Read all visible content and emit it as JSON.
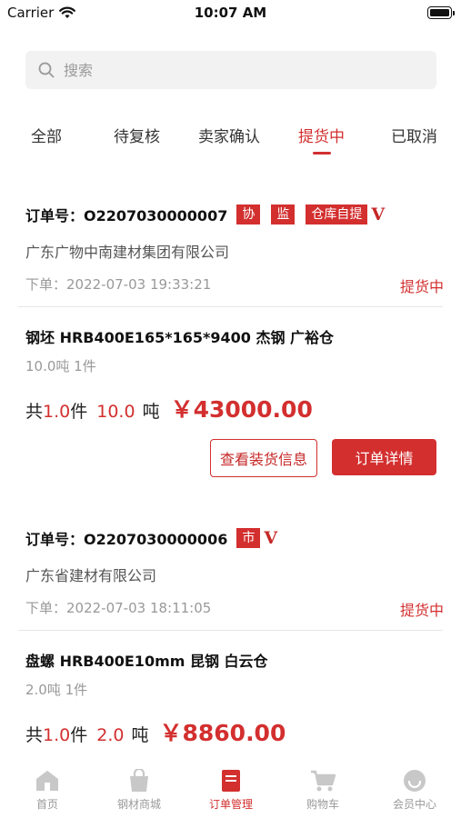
{
  "status_bar": {
    "carrier": "Carrier",
    "time": "10:07 AM"
  },
  "search": {
    "placeholder": "搜索"
  },
  "tabs": [
    {
      "label": "全部",
      "active": false
    },
    {
      "label": "待复核",
      "active": false
    },
    {
      "label": "卖家确认",
      "active": false
    },
    {
      "label": "提货中",
      "active": true
    },
    {
      "label": "已取消",
      "active": false
    }
  ],
  "orders": [
    {
      "order_no": "订单号：O2207030000007",
      "tags": [
        "协",
        "监",
        "仓库自提"
      ],
      "vip_mark": "V",
      "company": "广东广物中南建材集团有限公司",
      "time": "下单：2022-07-03 19:33:21",
      "status": "提货中",
      "product_name": "钢坯 HRB400E165*165*9400 杰钢 广裕仓",
      "product_qty": "10.0吨 1件",
      "summary_prefix": "共",
      "count": "1.0",
      "count_unit": "件",
      "weight": "10.0",
      "weight_unit": "吨",
      "price": "￥43000.00",
      "btn_loading": "查看装货信息",
      "btn_detail": "订单详情"
    },
    {
      "order_no": "订单号：O2207030000006",
      "tags": [
        "市"
      ],
      "vip_mark": "V",
      "company": "广东省建材有限公司",
      "time": "下单：2022-07-03 18:11:05",
      "status": "提货中",
      "product_name": "盘螺 HRB400E10mm 昆钢 白云仓",
      "product_qty": "2.0吨 1件",
      "summary_prefix": "共",
      "count": "1.0",
      "count_unit": "件",
      "weight": "2.0",
      "weight_unit": "吨",
      "price": "￥8860.00"
    }
  ],
  "tabbar": [
    {
      "label": "首页",
      "icon": "home-icon",
      "active": false
    },
    {
      "label": "钢材商城",
      "icon": "bag-icon",
      "active": false
    },
    {
      "label": "订单管理",
      "icon": "order-book-icon",
      "active": true
    },
    {
      "label": "购物车",
      "icon": "cart-icon",
      "active": false
    },
    {
      "label": "会员中心",
      "icon": "member-icon",
      "active": false
    }
  ],
  "colors": {
    "accent": "#d32f2f",
    "muted": "#999999",
    "search_bg": "#f2f2f2"
  }
}
